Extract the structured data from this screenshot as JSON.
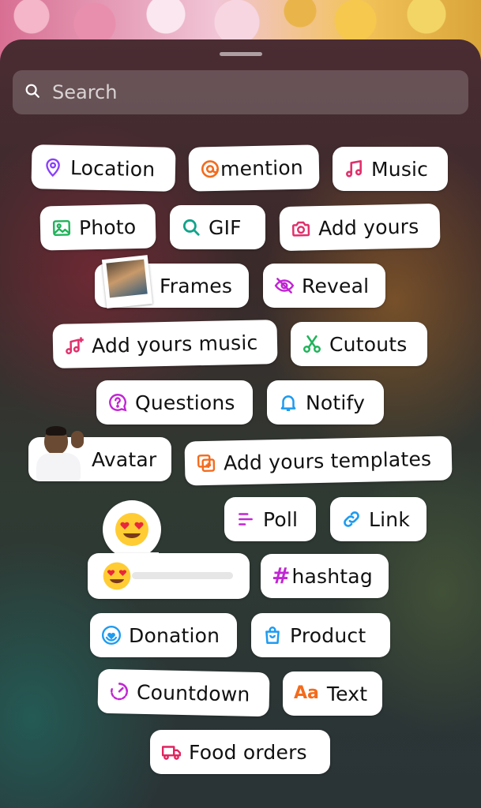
{
  "search": {
    "placeholder": "Search"
  },
  "stickers": {
    "location": "Location",
    "mention": "mention",
    "music": "Music",
    "photo": "Photo",
    "gif": "GIF",
    "add_yours": "Add yours",
    "frames": "Frames",
    "reveal": "Reveal",
    "add_yours_music": "Add yours music",
    "cutouts": "Cutouts",
    "questions": "Questions",
    "notify": "Notify",
    "avatar": "Avatar",
    "add_yours_templates": "Add yours templates",
    "poll": "Poll",
    "link": "Link",
    "hashtag": "hashtag",
    "hashtag_symbol": "#",
    "donation": "Donation",
    "product": "Product",
    "countdown": "Countdown",
    "text": "Text",
    "text_icon": "Aa",
    "food_orders": "Food orders"
  },
  "emoji_slider": {
    "emoji": "heart-eyes-face",
    "value": 0
  },
  "icons": {
    "location": "pin-icon",
    "mention": "threads-icon",
    "music": "music-note-icon",
    "photo": "image-icon",
    "gif": "search-icon",
    "add_yours": "camera-icon",
    "reveal": "eye-slash-icon",
    "add_yours_music": "music-plus-icon",
    "cutouts": "scissors-icon",
    "questions": "question-bubble-icon",
    "notify": "bell-icon",
    "add_yours_templates": "template-plus-icon",
    "poll": "poll-icon",
    "link": "link-icon",
    "donation": "donation-icon",
    "product": "shopping-bag-icon",
    "countdown": "timer-icon",
    "food_orders": "delivery-truck-icon"
  },
  "colors": {
    "purple": "#8a3ffc",
    "orange": "#f36b1c",
    "pink": "#e1306c",
    "green": "#20b35a",
    "teal": "#12a38a",
    "blue": "#1d9bf0",
    "magenta": "#c026d3",
    "red": "#e0245e"
  }
}
